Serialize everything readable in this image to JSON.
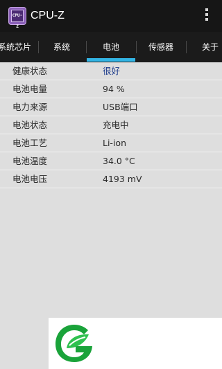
{
  "appbar": {
    "title": "CPU-Z",
    "icon_text": "CPU-Z",
    "icon": "cpu-z-app-icon",
    "menu_icon": "overflow-menu-icon"
  },
  "tabs": [
    {
      "label": "系统芯片"
    },
    {
      "label": "系统"
    },
    {
      "label": "电池"
    },
    {
      "label": "传感器"
    },
    {
      "label": "关于"
    }
  ],
  "active_tab": "电池",
  "battery": {
    "rows": [
      {
        "label": "健康状态",
        "value": "很好"
      },
      {
        "label": "电池电量",
        "value": "94 %"
      },
      {
        "label": "电力来源",
        "value": "USB端口"
      },
      {
        "label": "电池状态",
        "value": "充电中"
      },
      {
        "label": "电池工艺",
        "value": "Li-ion"
      },
      {
        "label": "电池温度",
        "value": "34.0 °C"
      },
      {
        "label": "电池电压",
        "value": "4193 mV"
      }
    ]
  },
  "watermark": {
    "icon": "green-leaf-logo-icon"
  },
  "colors": {
    "appbar_bg": "#161616",
    "tabbar_bg": "#1b1b1b",
    "tab_indicator": "#33b5e5",
    "content_bg": "#dedede",
    "highlight_value": "#1e3c8c",
    "logo_green": "#1aa33a"
  }
}
